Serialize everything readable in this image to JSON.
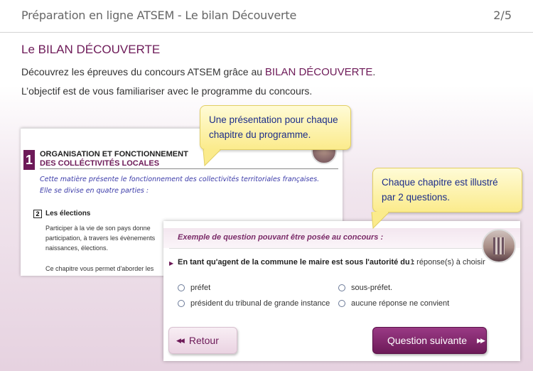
{
  "header": {
    "title": "Préparation en ligne ATSEM  - Le bilan Découverte",
    "page": "2/5"
  },
  "main": {
    "heading": "Le BILAN DÉCOUVERTE",
    "intro_prefix": "Découvrez les épreuves du concours ATSEM grâce au ",
    "intro_highlight": "BILAN DÉCOUVERTE",
    "intro_suffix": ".",
    "intro_line2": "L’objectif est de vous familiariser avec le programme du concours."
  },
  "doc_preview": {
    "chapter_number": "1",
    "title_line1": "ORGANISATION ET FONCTIONNEMENT",
    "title_line2": "DES COLLÉCTIVITÉS LOCALES",
    "hand_line1": "Cette matière présente le fonctionnement des collectivités territoriales françaises.",
    "hand_line2": "Elle se divise en quatre parties :",
    "section_number": "2",
    "section_title": "Les élections",
    "paragraph": "Participer à la vie de son pays donne participation, à travers les évènements naissances, élections.",
    "paragraph2": "Ce chapitre vous permet d'aborder les"
  },
  "callouts": {
    "first": "Une présentation pour chaque chapitre du programme.",
    "second": "Chaque chapitre est illustré par 2 questions."
  },
  "quiz": {
    "example_label": "Exemple de question pouvant être posée au concours :",
    "question": "En tant qu'agent de la commune le maire est sous l'autorité du :",
    "hint": "1 réponse(s) à choisir",
    "options": [
      "préfet",
      "sous-préfet.",
      "président du tribunal de grande instance",
      "aucune réponse ne convient"
    ],
    "back_label": "Retour",
    "next_label": "Question suivante"
  },
  "colors": {
    "accent": "#6d1a58",
    "callout_text": "#1c2d89",
    "callout_bg": "#fbeb8c"
  }
}
